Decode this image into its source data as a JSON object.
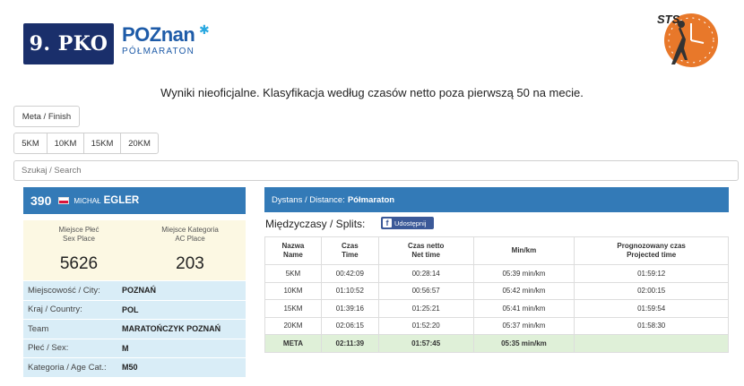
{
  "header": {
    "pko_logo": "9. PKO",
    "poznan_main": "POZnan",
    "poznan_sub": "PÓŁMARATON",
    "sts_logo": "STS",
    "headline": "Wyniki nieoficjalne. Klasyfikacja według czasów netto poza pierwszą 50 na mecie."
  },
  "buttons": {
    "finish": "Meta / Finish",
    "distances": [
      "5KM",
      "10KM",
      "15KM",
      "20KM"
    ]
  },
  "search": {
    "placeholder": "Szukaj / Search"
  },
  "athlete": {
    "bib": "390",
    "first_name": "Michał",
    "last_name": "EGLER",
    "sex_place_label": "Miejsce Płeć\nSex Place",
    "sex_place": "5626",
    "cat_place_label": "Miejsce Kategoria\nAC Place",
    "cat_place": "203",
    "info": [
      {
        "key": "Miejscowość / City:",
        "value": "POZNAŃ"
      },
      {
        "key": "Kraj / Country:",
        "value": "POL"
      },
      {
        "key": "Team",
        "value": "MARATOŃCZYK POZNAŃ"
      },
      {
        "key": "Płeć / Sex:",
        "value": "M"
      },
      {
        "key": "Kategoria / Age Cat.:",
        "value": "M50"
      }
    ]
  },
  "splits": {
    "distance_label": "Dystans / Distance:",
    "distance_value": "Półmaraton",
    "title": "Międzyczasy / Splits:",
    "share_label": "Udostępnij",
    "headers": [
      [
        "Nazwa",
        "Name"
      ],
      [
        "Czas",
        "Time"
      ],
      [
        "Czas netto",
        "Net time"
      ],
      [
        "Min/km",
        ""
      ],
      [
        "Prognozowany czas",
        "Projected time"
      ]
    ],
    "rows": [
      [
        "5KM",
        "00:42:09",
        "00:28:14",
        "05:39 min/km",
        "01:59:12"
      ],
      [
        "10KM",
        "01:10:52",
        "00:56:57",
        "05:42 min/km",
        "02:00:15"
      ],
      [
        "15KM",
        "01:39:16",
        "01:25:21",
        "05:41 min/km",
        "01:59:54"
      ],
      [
        "20KM",
        "02:06:15",
        "01:52:20",
        "05:37 min/km",
        "01:58:30"
      ]
    ],
    "meta_row": [
      "META",
      "02:11:39",
      "01:57:45",
      "05:35 min/km",
      ""
    ]
  },
  "colors": {
    "panel_blue": "#337ab7",
    "warning_bg": "#fcf8e3",
    "info_bg": "#d9edf7",
    "success_bg": "#dff0d8",
    "pko_navy": "#1a2f6b",
    "poznan_blue": "#1e5ba8",
    "sts_orange": "#e8782a"
  }
}
